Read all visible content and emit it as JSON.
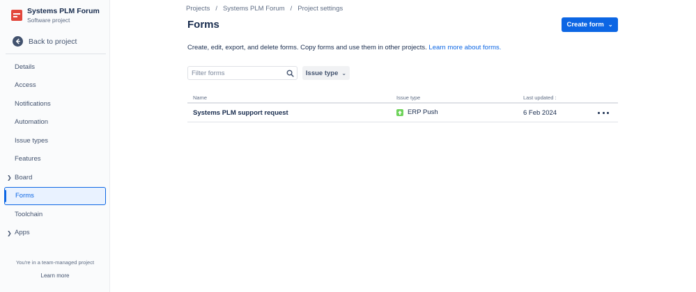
{
  "sidebar": {
    "project_name": "Systems PLM Forum",
    "project_type": "Software project",
    "back_label": "Back to project",
    "items": [
      {
        "label": "Details"
      },
      {
        "label": "Access"
      },
      {
        "label": "Notifications"
      },
      {
        "label": "Automation"
      },
      {
        "label": "Issue types"
      },
      {
        "label": "Features"
      },
      {
        "label": "Board"
      },
      {
        "label": "Forms"
      },
      {
        "label": "Toolchain"
      },
      {
        "label": "Apps"
      }
    ],
    "team_note": "You're in a team-managed project",
    "learn_more": "Learn more"
  },
  "breadcrumb": [
    "Projects",
    "Systems PLM Forum",
    "Project settings"
  ],
  "page": {
    "title": "Forms",
    "create_label": "Create form",
    "description": "Create, edit, export, and delete forms. Copy forms and use them in other projects.",
    "learn_more_link": "Learn more about forms.",
    "filter_placeholder": "Filter forms",
    "issue_type_filter": "Issue type"
  },
  "table": {
    "headers": {
      "name": "Name",
      "issue_type": "Issue type",
      "last_updated": "Last updated :"
    },
    "rows": [
      {
        "name": "Systems PLM support request",
        "issue_type": "ERP Push",
        "last_updated": "6 Feb 2024"
      }
    ]
  },
  "colors": {
    "accent": "#0c66e4",
    "issue_icon": "#6ed35a",
    "logo": "#e2483d"
  },
  "icons": [
    "project-logo-icon",
    "back-arrow-icon",
    "chevron-right-icon",
    "chevron-down-icon",
    "search-icon",
    "issue-type-icon",
    "more-icon"
  ]
}
